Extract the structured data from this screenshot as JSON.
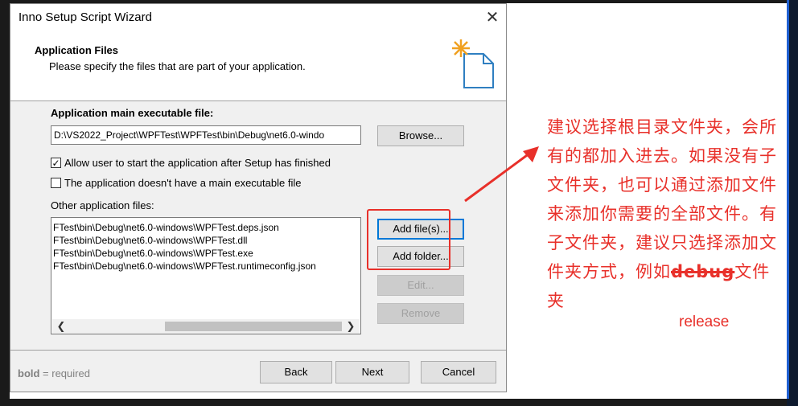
{
  "window": {
    "title": "Inno Setup Script Wizard",
    "close_glyph": "✕"
  },
  "header": {
    "title": "Application Files",
    "subtitle": "Please specify the files that are part of your application."
  },
  "main": {
    "exe_label": "Application main executable file:",
    "exe_value": "D:\\VS2022_Project\\WPFTest\\WPFTest\\bin\\Debug\\net6.0-windo",
    "browse_label": "Browse...",
    "allow_start_label": "Allow user to start the application after Setup has finished",
    "allow_start_checked": true,
    "no_exe_label": "The application doesn't have a main executable file",
    "no_exe_checked": false,
    "other_files_label": "Other application files:",
    "files": [
      "FTest\\bin\\Debug\\net6.0-windows\\WPFTest.deps.json",
      "FTest\\bin\\Debug\\net6.0-windows\\WPFTest.dll",
      "FTest\\bin\\Debug\\net6.0-windows\\WPFTest.exe",
      "FTest\\bin\\Debug\\net6.0-windows\\WPFTest.runtimeconfig.json"
    ],
    "add_files_label": "Add file(s)...",
    "add_folder_label": "Add folder...",
    "edit_label": "Edit...",
    "remove_label": "Remove"
  },
  "footer": {
    "hint_bold": "bold",
    "hint_rest": " = required",
    "back_label": "Back",
    "next_label": "Next",
    "cancel_label": "Cancel"
  },
  "annotation": {
    "text_before": "建议选择根目录文件夹，会所有的都加入进去。如果没有子文件夹，也可以通过添加文件来添加你需要的全部文件。有子文件夹，建议只选择添加文件夹方式，例如",
    "struck_word": "debug",
    "text_after": "文件夹",
    "replacement": "release",
    "color": "#e8302a"
  }
}
